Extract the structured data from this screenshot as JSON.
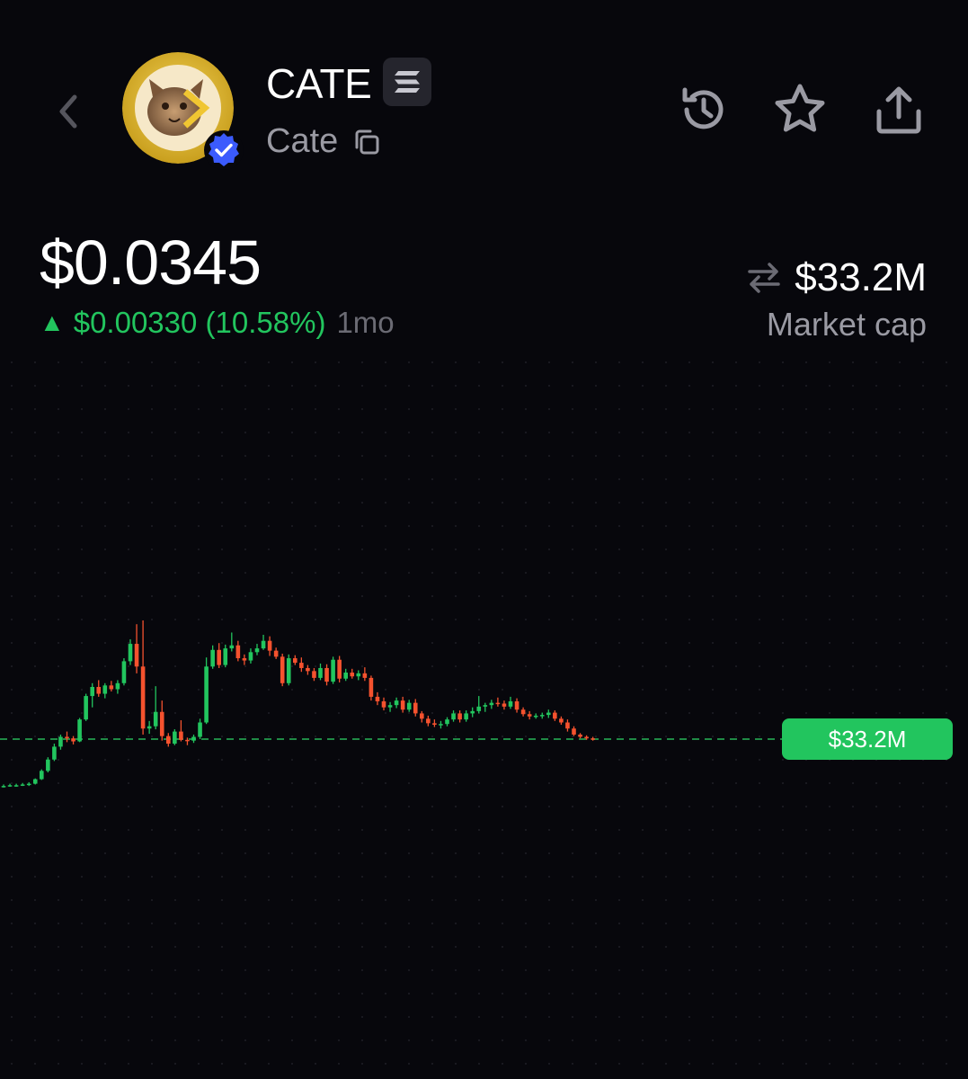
{
  "header": {
    "symbol": "CATE",
    "name": "Cate",
    "verified": true,
    "icons": {
      "back": "chevron-left-icon",
      "chain": "solana-icon",
      "copy": "copy-icon",
      "history": "history-icon",
      "favorite": "star-icon",
      "share": "share-icon"
    }
  },
  "price": {
    "value": "$0.0345",
    "change": "$0.00330 (10.58%)",
    "direction": "up",
    "period": "1mo"
  },
  "market_cap": {
    "value": "$33.2M",
    "label": "Market cap",
    "swap_icon": "swap-arrows-icon"
  },
  "colors": {
    "background": "#07070c",
    "up": "#22c55e",
    "down": "#f5522e",
    "muted": "#9a9aa3",
    "accent_blue": "#3b5bfd"
  },
  "chart_data": {
    "type": "candlestick",
    "current_label": "$33.2M",
    "current_value": 33.2,
    "unit": "$M market cap",
    "candles": [
      [
        27.0,
        27.2,
        26.8,
        27.0
      ],
      [
        27.0,
        27.3,
        26.9,
        27.1
      ],
      [
        27.1,
        27.3,
        26.9,
        27.1
      ],
      [
        27.1,
        27.4,
        27.0,
        27.2
      ],
      [
        27.2,
        27.5,
        27.0,
        27.3
      ],
      [
        27.3,
        28.0,
        27.2,
        27.9
      ],
      [
        27.9,
        29.2,
        27.8,
        29.0
      ],
      [
        29.0,
        30.8,
        28.8,
        30.5
      ],
      [
        30.5,
        32.6,
        30.3,
        32.2
      ],
      [
        32.2,
        33.8,
        31.8,
        33.5
      ],
      [
        33.5,
        34.2,
        32.8,
        33.3
      ],
      [
        33.3,
        33.6,
        32.5,
        32.9
      ],
      [
        32.9,
        36.0,
        32.8,
        35.8
      ],
      [
        35.8,
        39.2,
        35.6,
        38.9
      ],
      [
        38.9,
        40.6,
        37.4,
        40.1
      ],
      [
        40.1,
        41.0,
        38.8,
        39.2
      ],
      [
        39.2,
        40.6,
        38.6,
        40.3
      ],
      [
        40.3,
        40.9,
        39.5,
        39.8
      ],
      [
        39.8,
        41.0,
        39.2,
        40.6
      ],
      [
        40.6,
        43.9,
        40.3,
        43.5
      ],
      [
        43.5,
        46.4,
        43.0,
        45.8
      ],
      [
        45.8,
        48.4,
        41.9,
        42.8
      ],
      [
        42.8,
        48.9,
        33.8,
        34.6
      ],
      [
        34.6,
        35.6,
        33.9,
        34.9
      ],
      [
        34.9,
        40.2,
        34.5,
        36.8
      ],
      [
        36.8,
        38.3,
        33.0,
        33.6
      ],
      [
        33.6,
        34.0,
        32.2,
        32.6
      ],
      [
        32.6,
        34.5,
        32.4,
        34.2
      ],
      [
        34.2,
        35.7,
        32.9,
        33.1
      ],
      [
        33.1,
        33.4,
        32.4,
        33.0
      ],
      [
        33.0,
        33.8,
        32.7,
        33.5
      ],
      [
        33.5,
        35.9,
        33.2,
        35.4
      ],
      [
        35.4,
        44.0,
        35.2,
        42.8
      ],
      [
        42.8,
        45.6,
        42.5,
        45.0
      ],
      [
        45.0,
        45.9,
        42.6,
        43.0
      ],
      [
        43.0,
        45.7,
        42.7,
        45.2
      ],
      [
        45.2,
        47.3,
        44.8,
        45.6
      ],
      [
        45.6,
        46.2,
        43.5,
        43.9
      ],
      [
        43.9,
        44.4,
        43.0,
        43.6
      ],
      [
        43.6,
        45.2,
        43.2,
        44.7
      ],
      [
        44.7,
        45.8,
        44.3,
        45.2
      ],
      [
        45.2,
        47.0,
        45.0,
        46.2
      ],
      [
        46.2,
        46.8,
        44.2,
        44.9
      ],
      [
        44.9,
        45.3,
        43.8,
        44.1
      ],
      [
        44.1,
        44.5,
        40.2,
        40.6
      ],
      [
        40.6,
        44.4,
        40.3,
        43.9
      ],
      [
        43.9,
        44.3,
        43.0,
        43.3
      ],
      [
        43.3,
        44.0,
        42.1,
        42.6
      ],
      [
        42.6,
        43.0,
        41.7,
        42.2
      ],
      [
        42.2,
        42.6,
        40.9,
        41.3
      ],
      [
        41.3,
        43.2,
        41.0,
        42.6
      ],
      [
        42.6,
        43.1,
        40.3,
        40.8
      ],
      [
        40.8,
        44.1,
        40.5,
        43.7
      ],
      [
        43.7,
        44.2,
        40.7,
        41.2
      ],
      [
        41.2,
        42.5,
        40.9,
        42.0
      ],
      [
        42.0,
        42.5,
        41.2,
        41.5
      ],
      [
        41.5,
        42.3,
        41.0,
        41.9
      ],
      [
        41.9,
        42.7,
        40.9,
        41.3
      ],
      [
        41.3,
        41.6,
        38.3,
        38.8
      ],
      [
        38.8,
        39.4,
        37.7,
        38.2
      ],
      [
        38.2,
        38.7,
        37.0,
        37.4
      ],
      [
        37.4,
        38.1,
        36.8,
        37.7
      ],
      [
        37.7,
        38.7,
        37.3,
        38.3
      ],
      [
        38.3,
        38.8,
        36.7,
        37.1
      ],
      [
        37.1,
        38.4,
        36.8,
        38.0
      ],
      [
        38.0,
        38.5,
        36.2,
        36.6
      ],
      [
        36.6,
        36.9,
        35.4,
        35.9
      ],
      [
        35.9,
        36.3,
        34.9,
        35.3
      ],
      [
        35.3,
        35.8,
        34.8,
        35.1
      ],
      [
        35.1,
        35.6,
        34.6,
        35.2
      ],
      [
        35.2,
        36.1,
        34.9,
        35.8
      ],
      [
        35.8,
        37.0,
        35.5,
        36.6
      ],
      [
        36.6,
        37.0,
        35.4,
        35.8
      ],
      [
        35.8,
        37.0,
        35.5,
        36.6
      ],
      [
        36.6,
        37.4,
        36.1,
        36.9
      ],
      [
        36.9,
        38.9,
        36.6,
        37.5
      ],
      [
        37.5,
        38.0,
        36.8,
        37.7
      ],
      [
        37.7,
        38.4,
        37.2,
        38.0
      ],
      [
        38.0,
        38.7,
        37.5,
        37.9
      ],
      [
        37.9,
        38.3,
        37.1,
        37.5
      ],
      [
        37.5,
        38.8,
        37.2,
        38.2
      ],
      [
        38.2,
        38.6,
        36.7,
        37.1
      ],
      [
        37.1,
        37.4,
        36.2,
        36.5
      ],
      [
        36.5,
        36.9,
        35.8,
        36.2
      ],
      [
        36.2,
        36.6,
        35.9,
        36.3
      ],
      [
        36.3,
        36.7,
        35.9,
        36.4
      ],
      [
        36.4,
        37.1,
        36.0,
        36.7
      ],
      [
        36.7,
        37.0,
        35.6,
        35.9
      ],
      [
        35.9,
        36.2,
        35.1,
        35.4
      ],
      [
        35.4,
        35.8,
        34.2,
        34.6
      ],
      [
        34.6,
        34.9,
        33.6,
        33.8
      ],
      [
        33.8,
        34.0,
        33.3,
        33.5
      ],
      [
        33.5,
        33.7,
        33.1,
        33.3
      ],
      [
        33.3,
        33.5,
        33.0,
        33.2
      ]
    ]
  }
}
